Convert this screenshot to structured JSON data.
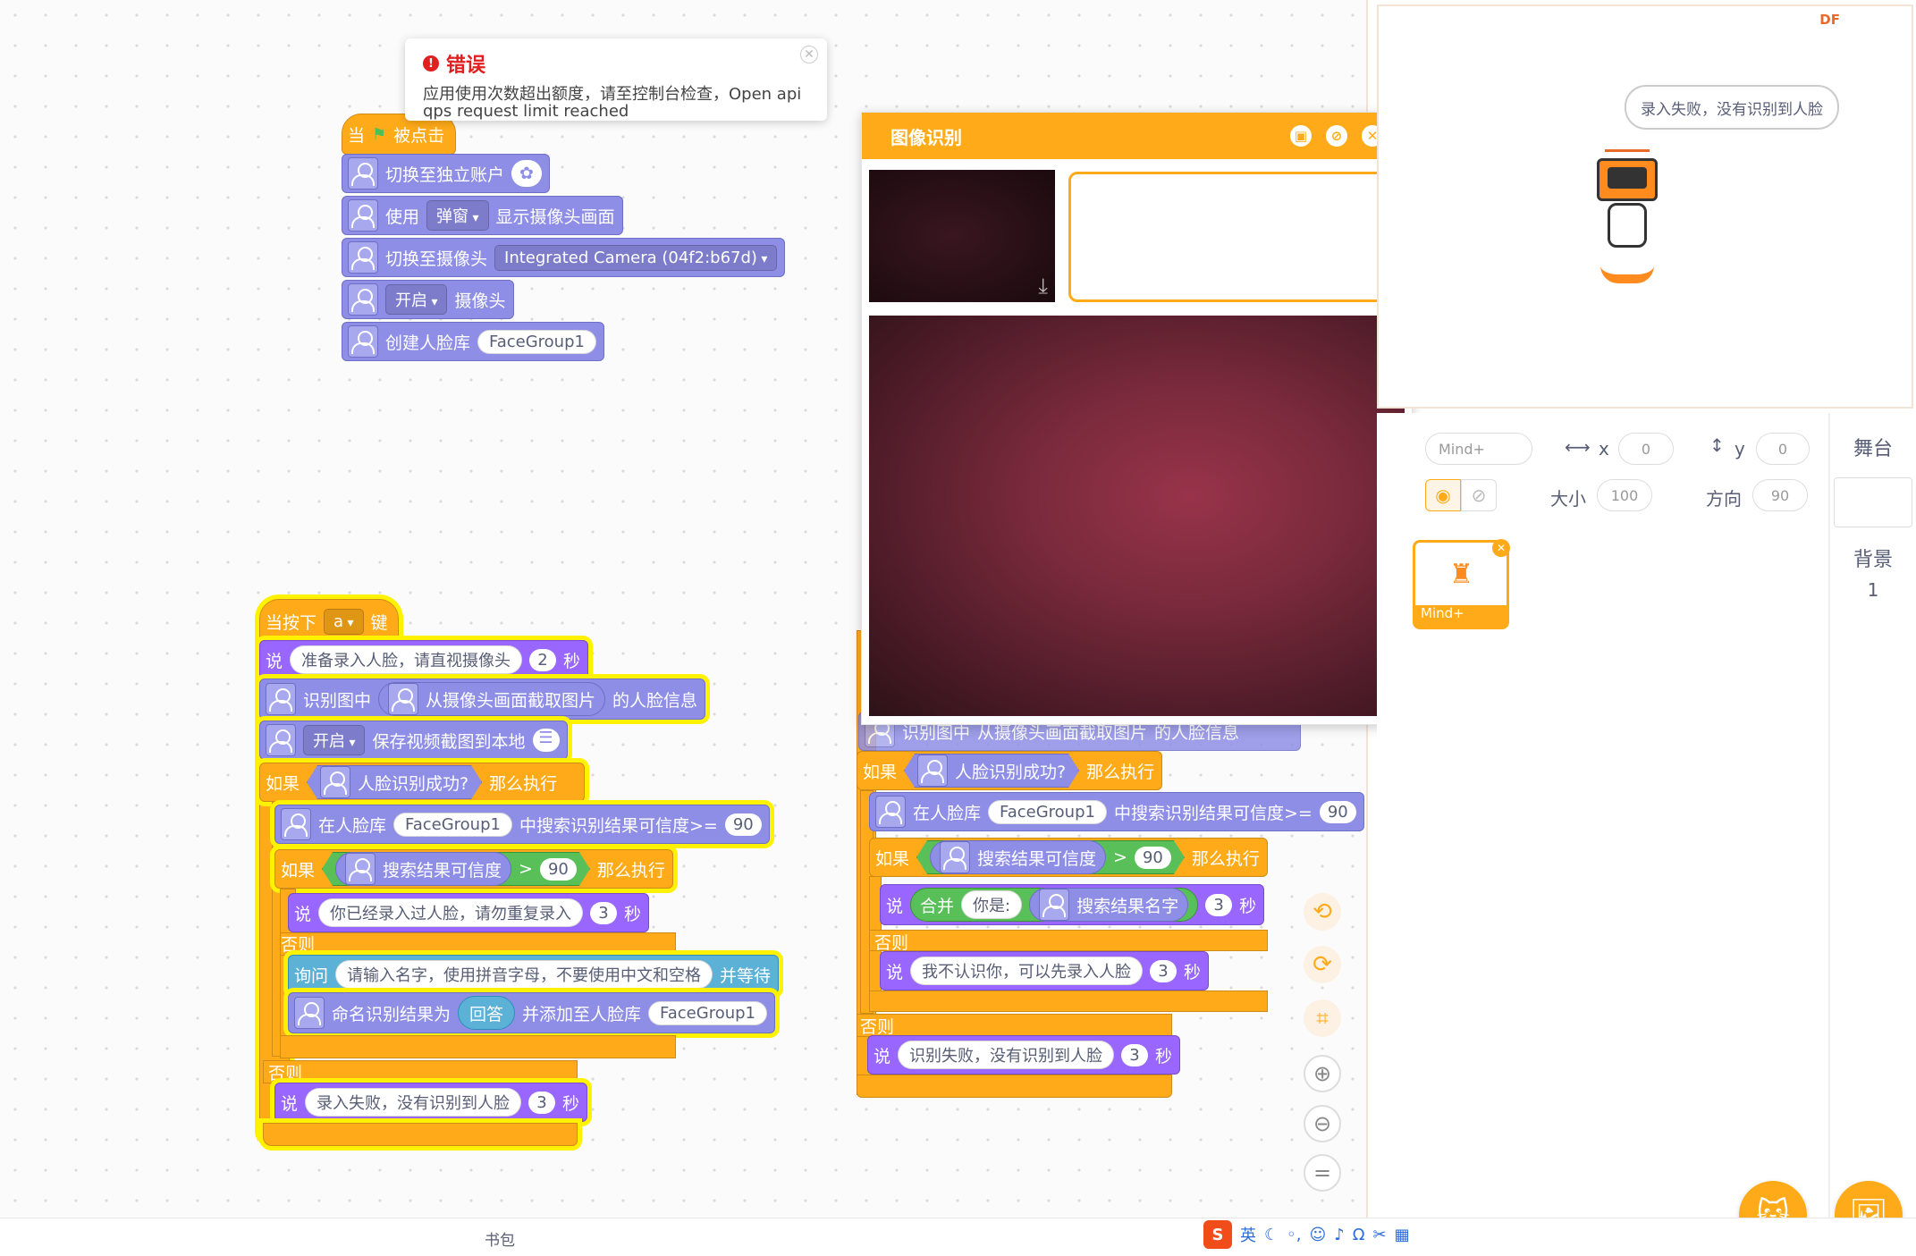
{
  "error": {
    "title": "错误",
    "line1": "应用使用次数超出额度，请至控制台检查，Open api",
    "line2": "qps request limit reached"
  },
  "script1": {
    "hat_when": "当",
    "hat_clicked": "被点击",
    "b1": "切换至独立账户",
    "b2_use": "使用",
    "b2_dd": "弹窗",
    "b2_show": "显示摄像头画面",
    "b3": "切换至摄像头",
    "b3_dd": "Integrated Camera (04f2:b67d)",
    "b4_dd": "开启",
    "b4": "摄像头",
    "b5": "创建人脸库",
    "b5_val": "FaceGroup1"
  },
  "script2": {
    "hat_pre": "当按下",
    "hat_dd": "a",
    "hat_post": "键",
    "say": "说",
    "say1": "准备录入人脸，请直视摄像头",
    "say1_n": "2",
    "sec": "秒",
    "recog_pre": "识别图中",
    "recog_inner": "从摄像头画面截取图片",
    "recog_post": "的人脸信息",
    "save_dd": "开启",
    "save": "保存视频截图到本地",
    "if": "如果",
    "then": "那么执行",
    "else": "否则",
    "cond1": "人脸识别成功?",
    "search_pre": "在人脸库",
    "search_val": "FaceGroup1",
    "search_post": "中搜索识别结果可信度>=",
    "search_n": "90",
    "cond2": "搜索结果可信度",
    "gt": ">",
    "cond2_n": "90",
    "say2": "你已经录入过人脸，请勿重复录入",
    "say2_n": "3",
    "ask": "询问",
    "ask_text": "请输入名字，使用拼音字母，不要使用中文和空格",
    "ask_wait": "并等待",
    "name_pre": "命名识别结果为",
    "answer": "回答",
    "name_post": "并添加至人脸库",
    "name_val": "FaceGroup1",
    "say3": "录入失败，没有识别到人脸",
    "say3_n": "3"
  },
  "script3": {
    "hidden": "识别图中",
    "hidden2": "从摄像头画面截取图片",
    "hidden3": "的人脸信息",
    "if": "如果",
    "then": "那么执行",
    "else": "否则",
    "cond1": "人脸识别成功?",
    "search_pre": "在人脸库",
    "search_val": "FaceGroup1",
    "search_post": "中搜索识别结果可信度>=",
    "search_n": "90",
    "cond2": "搜索结果可信度",
    "gt": ">",
    "cond2_n": "90",
    "say": "说",
    "join": "合并",
    "join_a": "你是:",
    "join_b": "搜索结果名字",
    "n3": "3",
    "sec": "秒",
    "say2": "我不认识你，可以先录入人脸",
    "say3": "识别失败，没有识别到人脸"
  },
  "popup": {
    "title": "图像识别"
  },
  "stage": {
    "badge": "DF",
    "bubble": "录入失败，没有识别到人脸"
  },
  "sprite": {
    "name": "Mind+",
    "x_label": "x",
    "x": "0",
    "y_label": "y",
    "y": "0",
    "size_label": "大小",
    "size": "100",
    "dir_label": "方向",
    "dir": "90",
    "thumb_label": "Mind+"
  },
  "stagecol": {
    "title": "舞台",
    "bg_label": "背景",
    "bg_count": "1"
  },
  "bottom": {
    "backpack": "书包",
    "ime": "英"
  },
  "colors": {
    "control": "#ffab19",
    "extension": "#8e8ee6",
    "looks": "#9966ff",
    "sensing": "#5cb1d6",
    "operator": "#59c059",
    "error": "#e02020"
  }
}
